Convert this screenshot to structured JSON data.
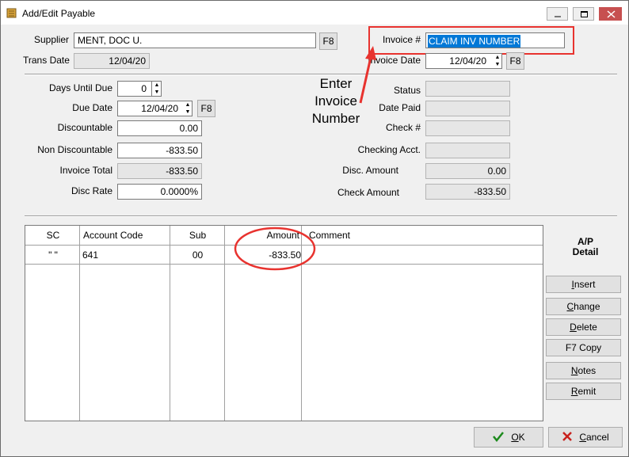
{
  "window": {
    "title": "Add/Edit Payable"
  },
  "header": {
    "supplier_label": "Supplier",
    "supplier_value": "MENT, DOC U.",
    "f8_label": "F8",
    "trans_date_label": "Trans Date",
    "trans_date_value": "12/04/20",
    "invoice_no_label": "Invoice #",
    "invoice_no_value": "CLAIM INV NUMBER",
    "invoice_date_label": "Invoice Date",
    "invoice_date_value": "12/04/20"
  },
  "left": {
    "days_until_due_label": "Days Until Due",
    "days_until_due_value": "0",
    "due_date_label": "Due Date",
    "due_date_value": "12/04/20",
    "discountable_label": "Discountable",
    "discountable_value": "0.00",
    "non_discountable_label": "Non Discountable",
    "non_discountable_value": "-833.50",
    "invoice_total_label": "Invoice Total",
    "invoice_total_value": "-833.50",
    "disc_rate_label": "Disc Rate",
    "disc_rate_value": "0.0000%"
  },
  "right": {
    "status_label": "Status",
    "status_value": "",
    "date_paid_label": "Date Paid",
    "date_paid_value": "",
    "check_no_label": "Check #",
    "check_no_value": "",
    "checking_acct_label": "Checking Acct.",
    "checking_acct_value": "",
    "disc_amount_label": "Disc. Amount",
    "disc_amount_value": "0.00",
    "check_amount_label": "Check Amount",
    "check_amount_value": "-833.50"
  },
  "annotation": {
    "line1": "Enter",
    "line2": "Invoice",
    "line3": "Number",
    "accent": "#e8332f"
  },
  "grid": {
    "columns": [
      "SC",
      "Account Code",
      "Sub",
      "Amount",
      "Comment"
    ],
    "rows": [
      {
        "sc": "\" \"",
        "account_code": "641",
        "sub": "00",
        "amount": "-833.50",
        "comment": ""
      }
    ]
  },
  "side_panel": {
    "title_line1": "A/P",
    "title_line2": "Detail",
    "insert_u": "I",
    "insert_rest": "nsert",
    "change_u": "C",
    "change_rest": "hange",
    "delete_u": "D",
    "delete_rest": "elete",
    "copy_label": "F7 Copy",
    "notes_u": "N",
    "notes_rest": "otes",
    "remit_u": "R",
    "remit_rest": "emit"
  },
  "footer": {
    "ok_u": "O",
    "ok_rest": "K",
    "cancel_u": "C",
    "cancel_rest": "ancel"
  }
}
